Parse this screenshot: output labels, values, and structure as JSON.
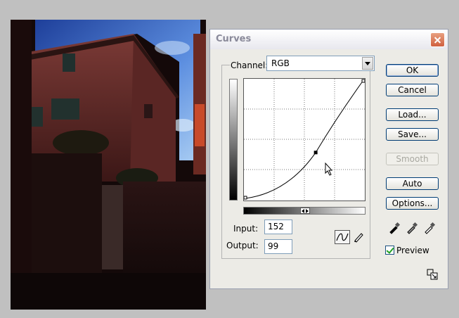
{
  "dialog": {
    "title": "Curves",
    "channel_label": "Channel:",
    "channel_value": "RGB",
    "input_label": "Input:",
    "input_value": "152",
    "output_label": "Output:",
    "output_value": "99",
    "buttons": {
      "ok": "OK",
      "cancel": "Cancel",
      "load": "Load...",
      "save": "Save...",
      "smooth": "Smooth",
      "auto": "Auto",
      "options": "Options..."
    },
    "preview_label": "Preview",
    "preview_checked": true,
    "curve_point": {
      "input": 152,
      "output": 99
    }
  },
  "colors": {
    "title_text": "#8a8a9a",
    "button_border": "#003c74",
    "close_button": "#d06040"
  },
  "icons": {
    "close": "close-icon",
    "curve_tool": "curve-tool-icon",
    "pencil_tool": "pencil-icon",
    "black_eyedropper": "black-eyedropper-icon",
    "gray_eyedropper": "gray-eyedropper-icon",
    "white_eyedropper": "white-eyedropper-icon",
    "resize": "resize-icon"
  }
}
